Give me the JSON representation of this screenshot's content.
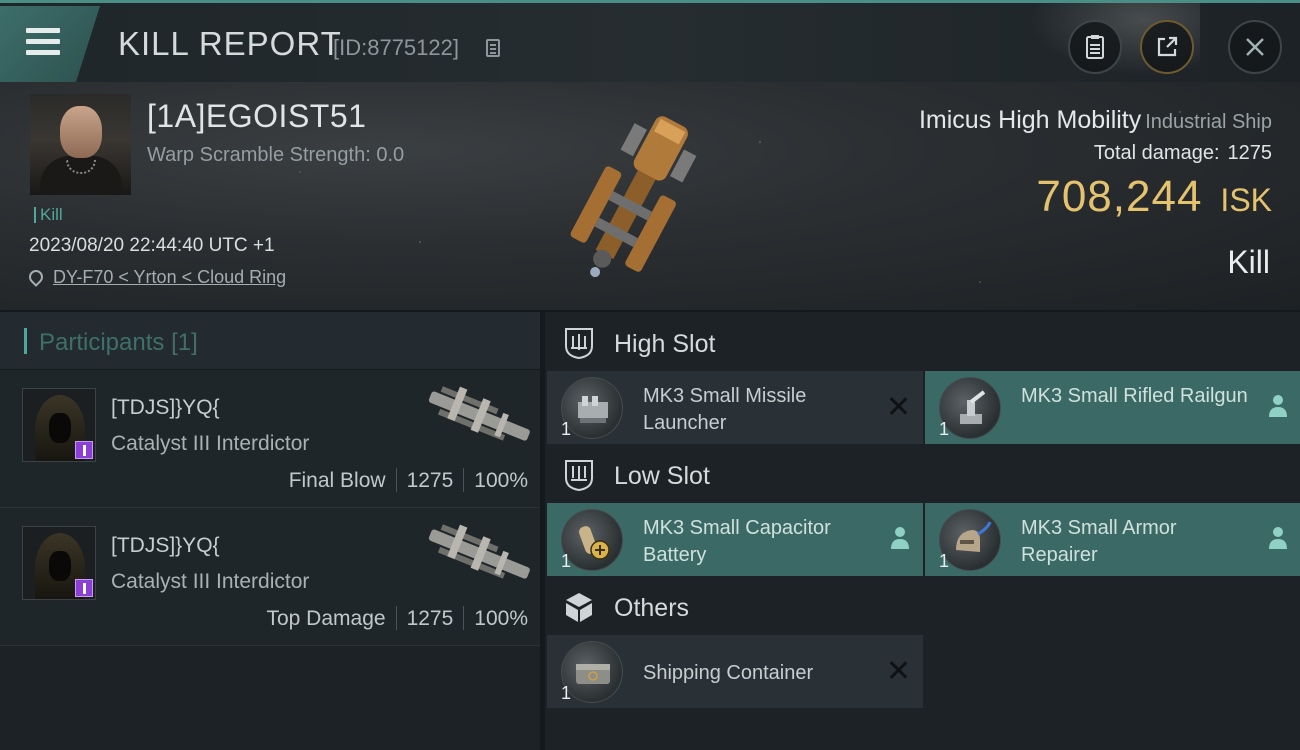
{
  "header": {
    "title": "KILL REPORT",
    "report_id": "[ID:8775122]",
    "buttons": [
      "clipboard-icon",
      "share-icon",
      "close-icon"
    ]
  },
  "victim": {
    "name": "[1A]EGOIST51",
    "warp_scramble": "Warp Scramble Strength: 0.0",
    "result_tag": "Kill",
    "datetime": "2023/08/20 22:44:40 UTC +1",
    "location": "DY-F70 < Yrton < Cloud Ring",
    "ship_name": "Imicus High Mobility",
    "ship_class": "Industrial Ship",
    "total_damage_label": "Total damage:",
    "total_damage": "1275",
    "isk_value": "708,244",
    "isk_unit": "ISK",
    "outcome": "Kill"
  },
  "participants": {
    "title": "Participants",
    "count": "[1]",
    "rows": [
      {
        "name": "[TDJS]}YQ{",
        "ship": "Catalyst III Interdictor",
        "role": "Final Blow",
        "damage": "1275",
        "percent": "100%"
      },
      {
        "name": "[TDJS]}YQ{",
        "ship": "Catalyst III Interdictor",
        "role": "Top Damage",
        "damage": "1275",
        "percent": "100%"
      }
    ]
  },
  "slots": {
    "high": {
      "label": "High Slot",
      "items": [
        {
          "qty": "1",
          "name": "MK3 Small Missile Launcher",
          "status": "destroyed"
        },
        {
          "qty": "1",
          "name": "MK3 Small Rifled Railgun",
          "status": "dropped"
        }
      ]
    },
    "low": {
      "label": "Low Slot",
      "items": [
        {
          "qty": "1",
          "name": "MK3 Small Capacitor Battery",
          "status": "dropped"
        },
        {
          "qty": "1",
          "name": "MK3 Small Armor Repairer",
          "status": "dropped"
        }
      ]
    },
    "others": {
      "label": "Others",
      "items": [
        {
          "qty": "1",
          "name": "Shipping Container",
          "status": "destroyed"
        }
      ]
    }
  },
  "colors": {
    "accent": "#4fa89b",
    "fitted_bg": "#3b6a66",
    "isk": "#e5c26e",
    "panel": "#1c2226"
  }
}
